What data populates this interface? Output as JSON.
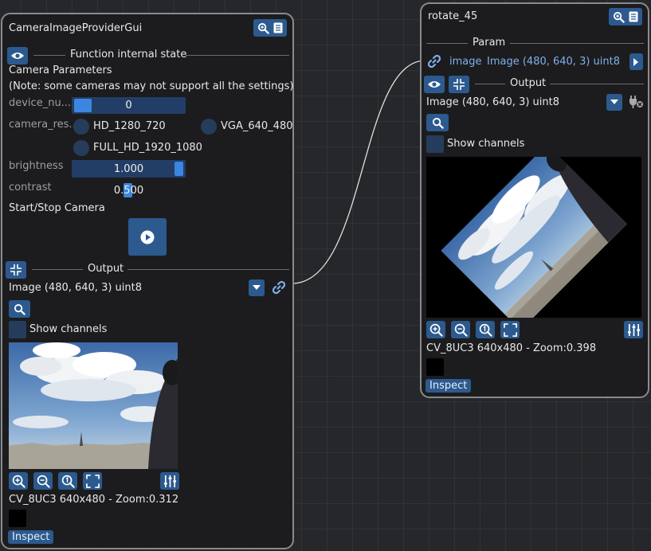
{
  "link_color": "#e0e0e0",
  "accent": "#3b86e0",
  "node1": {
    "title": "CameraImageProviderGui",
    "header_icons": [
      "zoom-icon",
      "doc-icon"
    ],
    "fis_separator": "Function internal state",
    "params_title": "Camera Parameters",
    "params_note": "(Note: some cameras may not support all the settings)",
    "device_number": {
      "label": "device_nu...",
      "value": "0"
    },
    "camera_resolution": {
      "label": "camera_res...",
      "options": [
        "HD_1280_720",
        "VGA_640_480",
        "FULL_HD_1920_1080"
      ]
    },
    "brightness": {
      "label": "brightness",
      "value": "1.000"
    },
    "contrast": {
      "label": "contrast",
      "value": "0.500"
    },
    "start_stop_label": "Start/Stop Camera",
    "output_separator": "Output",
    "output_type": "Image (480, 640, 3) uint8",
    "show_channels": "Show channels",
    "image_info": "CV_8UC3 640x480 - Zoom:0.312",
    "inspect_label": "Inspect"
  },
  "node2": {
    "title": "rotate_45",
    "header_icons": [
      "zoom-icon",
      "doc-icon"
    ],
    "param_separator": "Param",
    "param_name": "image",
    "param_value": "Image (480, 640, 3) uint8",
    "output_separator": "Output",
    "output_type": "Image (480, 640, 3) uint8",
    "show_channels": "Show channels",
    "image_info": "CV_8UC3 640x480 - Zoom:0.398",
    "inspect_label": "Inspect"
  }
}
